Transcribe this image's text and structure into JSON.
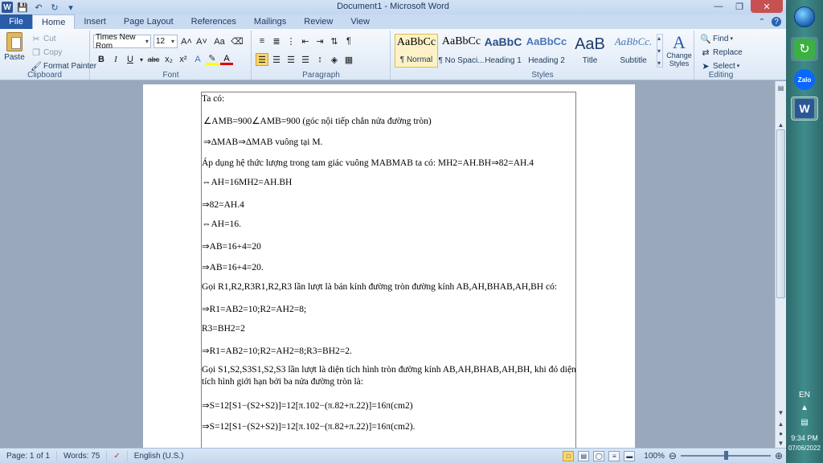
{
  "window": {
    "title": "Document1 - Microsoft Word"
  },
  "tabs": [
    {
      "label": "File"
    },
    {
      "label": "Home"
    },
    {
      "label": "Insert"
    },
    {
      "label": "Page Layout"
    },
    {
      "label": "References"
    },
    {
      "label": "Mailings"
    },
    {
      "label": "Review"
    },
    {
      "label": "View"
    }
  ],
  "clipboard": {
    "group_label": "Clipboard",
    "paste": "Paste",
    "cut": "Cut",
    "copy": "Copy",
    "format_painter": "Format Painter"
  },
  "font": {
    "group_label": "Font",
    "name": "Times New Rom",
    "size": "12",
    "grow": "A˄",
    "shrink": "A˅",
    "case": "Aa",
    "bold": "B",
    "italic": "I",
    "underline": "U",
    "strike": "abc",
    "subscript": "x₂",
    "superscript": "x²"
  },
  "paragraph": {
    "group_label": "Paragraph",
    "pilcrow": "¶"
  },
  "styles": {
    "group_label": "Styles",
    "items": [
      {
        "sample": "AaBbCc",
        "name": "¶ Normal"
      },
      {
        "sample": "AaBbCc",
        "name": "¶ No Spaci..."
      },
      {
        "sample": "AaBbC",
        "name": "Heading 1"
      },
      {
        "sample": "AaBbCc",
        "name": "Heading 2"
      },
      {
        "sample": "AaB",
        "name": "Title"
      },
      {
        "sample": "AaBbCc.",
        "name": "Subtitle"
      }
    ],
    "change_styles": "Change Styles"
  },
  "editing": {
    "group_label": "Editing",
    "find": "Find",
    "replace": "Replace",
    "select": "Select"
  },
  "document": {
    "paragraphs": [
      "Ta có:",
      "∠AMB=900∠AMB=900 (góc nội tiếp chắn nửa đường tròn)",
      "⇒ΔMAB⇒ΔMAB vuông tại M.",
      "Áp dụng hệ thức lượng trong tam giác vuông MABMAB ta có: MH2=AH.BH⇒82=AH.4",
      "⇔AH=16MH2=AH.BH",
      "⇒82=AH.4",
      "⇔AH=16.",
      "⇒AB=16+4=20",
      "⇒AB=16+4=20.",
      "Gọi R1,R2,R3R1,R2,R3 lần lượt là bán kính đường tròn đường kính AB,AH,BHAB,AH,BH có:",
      "⇒R1=AB2=10;R2=AH2=8;",
      "R3=BH2=2",
      "⇒R1=AB2=10;R2=AH2=8;R3=BH2=2.",
      "Gọi S1,S2,S3S1,S2,S3 lần lượt là diện tích hình tròn đường kính AB,AH,BHAB,AH,BH, khi đó diện tích hình giới hạn bởi ba nửa đường tròn là:",
      "⇒S=12[S1−(S2+S2)]=12[π.102−(π.82+π.22)]=16π(cm2)",
      "⇒S=12[S1−(S2+S2)]=12[π.102−(π.82+π.22)]=16π(cm2)."
    ]
  },
  "status": {
    "page": "Page: 1 of 1",
    "words": "Words: 75",
    "language": "English (U.S.)",
    "zoom": "100%"
  },
  "taskbar": {
    "lang": "EN",
    "time": "9:34 PM",
    "date": "07/06/2022",
    "zalo": "Zalo",
    "word": "W"
  }
}
